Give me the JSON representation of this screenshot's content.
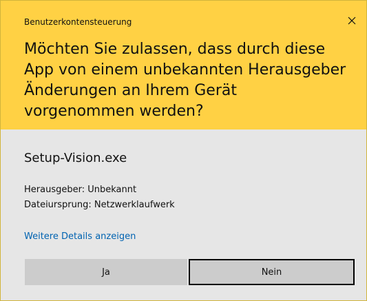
{
  "dialog": {
    "caption": "Benutzerkontensteuerung",
    "question": "Möchten Sie zulassen, dass durch diese App von einem unbekannten Herausgeber Änderungen an Ihrem Gerät vorgenommen werden?",
    "app_name": "Setup-Vision.exe",
    "publisher": "Herausgeber: Unbekannt",
    "origin": "Dateiursprung: Netzwerklaufwerk",
    "details_link": "Weitere Details anzeigen",
    "yes_label": "Ja",
    "no_label": "Nein"
  },
  "colors": {
    "header_bg": "#ffd144",
    "body_bg": "#e6e6e6",
    "link": "#0063b1",
    "button_bg": "#cccccc"
  },
  "icons": {
    "close": "close-icon"
  }
}
